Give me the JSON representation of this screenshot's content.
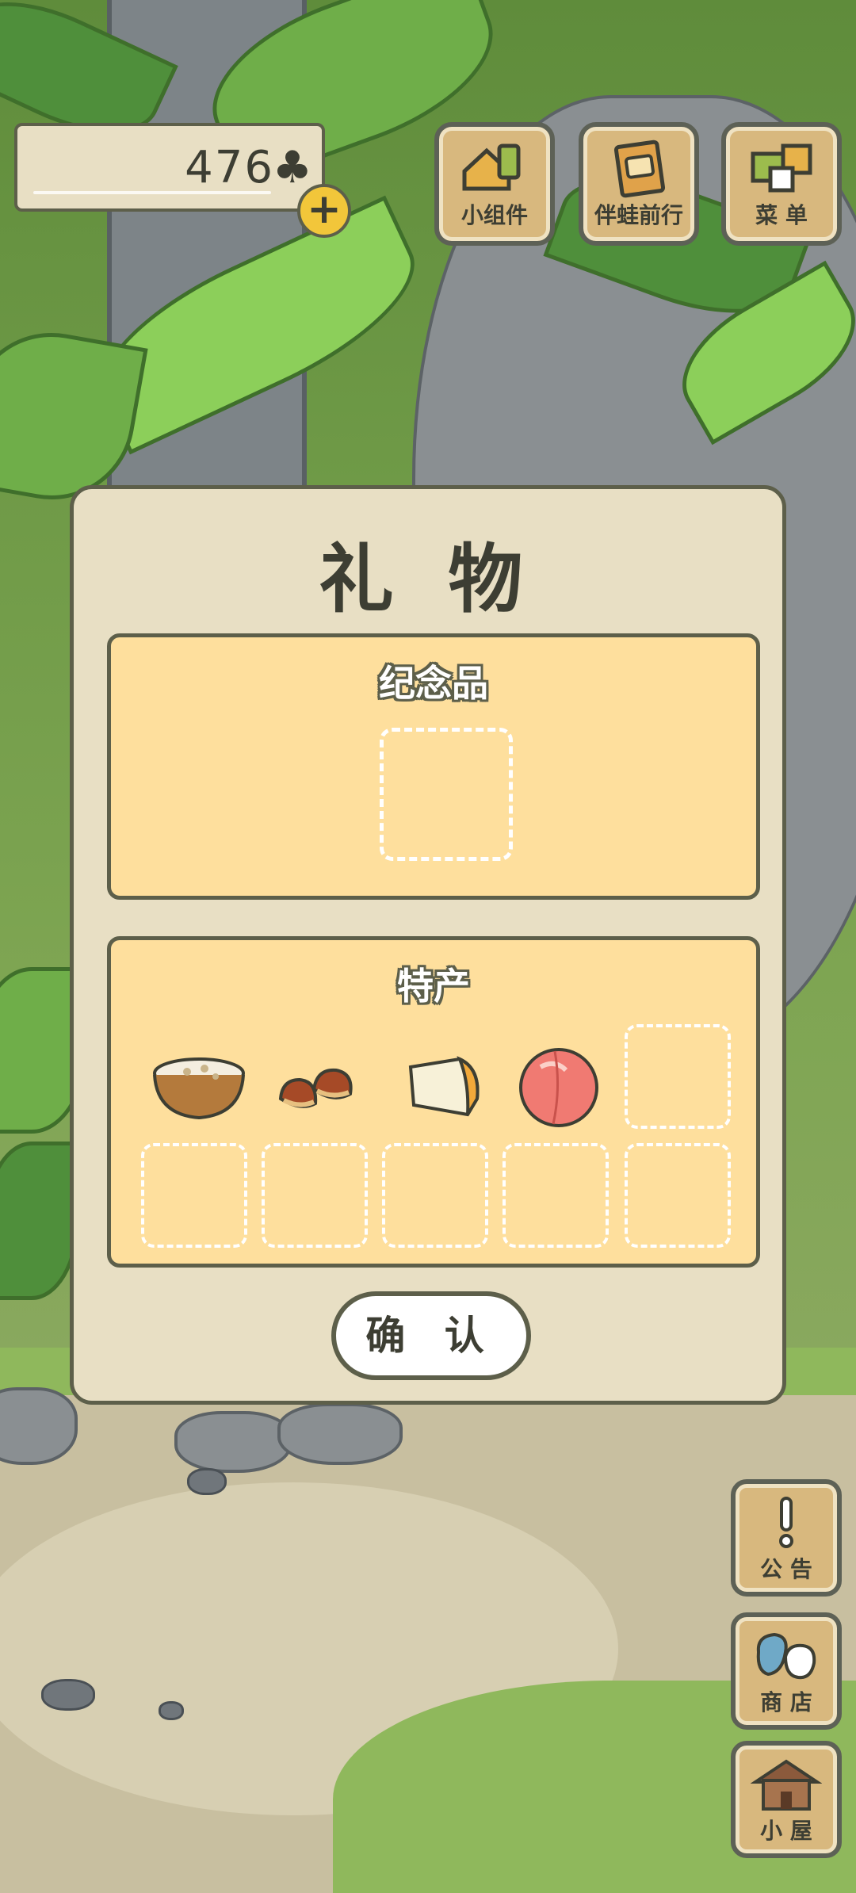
{
  "hud": {
    "clover_count": "476",
    "clover_symbol": "♣",
    "add_symbol": "+"
  },
  "top_menu": [
    {
      "label": "小组件",
      "icon": "widget-icon"
    },
    {
      "label": "伴蛙前行",
      "icon": "album-icon"
    },
    {
      "label": "菜 单",
      "icon": "menu-cards-icon"
    }
  ],
  "dialog": {
    "title": "礼 物",
    "souvenir": {
      "title": "纪念品"
    },
    "specialty": {
      "title": "特产",
      "items": [
        {
          "name": "rice-porridge-icon"
        },
        {
          "name": "chestnuts-icon"
        },
        {
          "name": "cheese-icon"
        },
        {
          "name": "peach-icon"
        }
      ]
    },
    "confirm_label": "确 认"
  },
  "side_menu": [
    {
      "label": "公 告",
      "icon": "exclamation-icon"
    },
    {
      "label": "商 店",
      "icon": "bags-icon"
    },
    {
      "label": "小 屋",
      "icon": "house-icon"
    }
  ],
  "colors": {
    "panel_fill": "#fedf9d",
    "dialog_fill": "#e8dfc4",
    "outline": "#5d5f4a",
    "tile_wood": "#d8b87e"
  }
}
